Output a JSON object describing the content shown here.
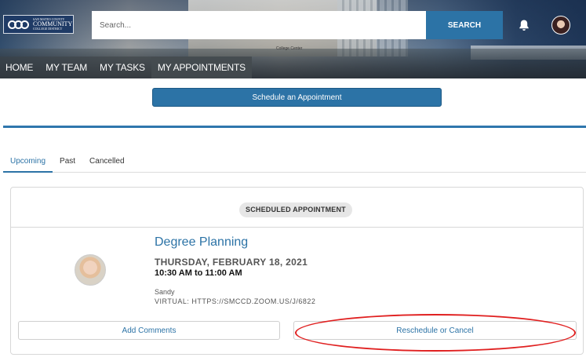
{
  "header": {
    "logo": {
      "text_small": "SAN MATEO COUNTY",
      "text_big": "COMMUNITY",
      "text_bottom": "COLLEGE DISTRICT"
    },
    "banner_sign": "College Center",
    "search": {
      "placeholder": "Search...",
      "button_label": "SEARCH"
    },
    "icons": {
      "notifications": "bell-icon",
      "profile": "avatar"
    }
  },
  "nav": {
    "items": [
      {
        "label": "HOME",
        "active": false
      },
      {
        "label": "MY TEAM",
        "active": false
      },
      {
        "label": "MY TASKS",
        "active": false
      },
      {
        "label": "MY APPOINTMENTS",
        "active": true
      }
    ]
  },
  "schedule_button_label": "Schedule an Appointment",
  "tabs": [
    {
      "label": "Upcoming",
      "active": true
    },
    {
      "label": "Past",
      "active": false
    },
    {
      "label": "Cancelled",
      "active": false
    }
  ],
  "appointment": {
    "status_badge": "SCHEDULED APPOINTMENT",
    "title": "Degree Planning",
    "date": "THURSDAY, FEBRUARY 18, 2021",
    "time": "10:30 AM to 11:00 AM",
    "person": "Sandy",
    "location": "VIRTUAL: HTTPS://SMCCD.ZOOM.US/J/6822",
    "add_comments_label": "Add Comments",
    "reschedule_label": "Reschedule or Cancel"
  },
  "colors": {
    "accent": "#2c73a6",
    "highlight": "#e02020"
  }
}
